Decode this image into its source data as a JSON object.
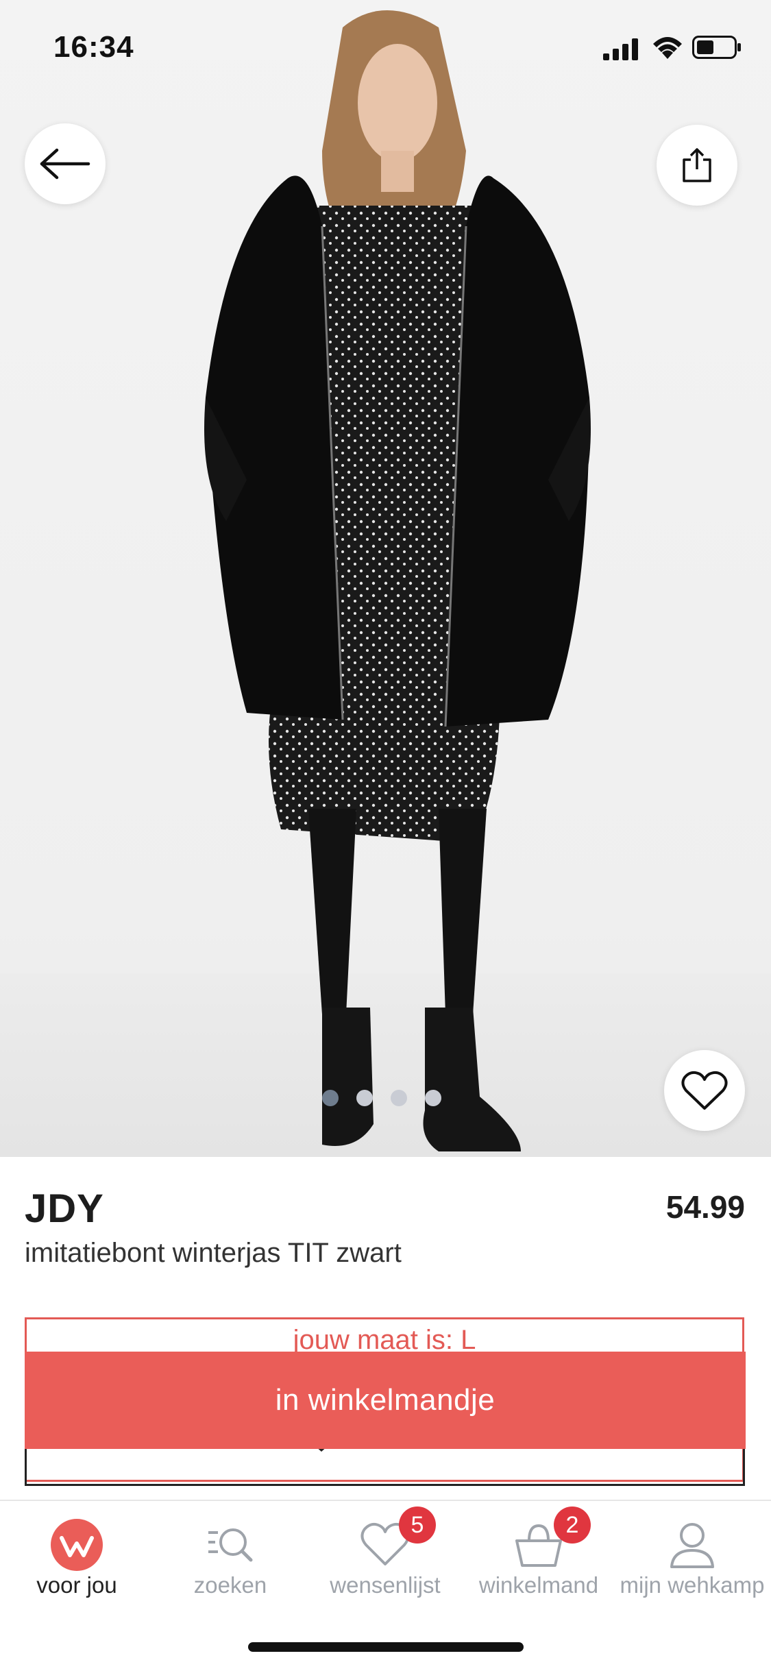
{
  "status_bar": {
    "time": "16:34"
  },
  "product": {
    "brand": "JDY",
    "price": "54.99",
    "name": "imitatiebont winterjas TIT zwart",
    "image_count": 4,
    "active_image": 1
  },
  "size_selector": {
    "label": "jouw maat is: L"
  },
  "cart_button": {
    "label": "in winkelmandje"
  },
  "nav": {
    "items": [
      {
        "label": "voor jou",
        "icon": "wehkamp-logo-icon",
        "active": true
      },
      {
        "label": "zoeken",
        "icon": "search-icon"
      },
      {
        "label": "wensenlijst",
        "icon": "heart-icon",
        "badge": "5"
      },
      {
        "label": "winkelmand",
        "icon": "basket-icon",
        "badge": "2"
      },
      {
        "label": "mijn wehkamp",
        "icon": "user-icon"
      }
    ]
  },
  "colors": {
    "accent": "#ea5d58",
    "badge": "#e0363f",
    "nav_inactive": "#9ea3aa"
  }
}
